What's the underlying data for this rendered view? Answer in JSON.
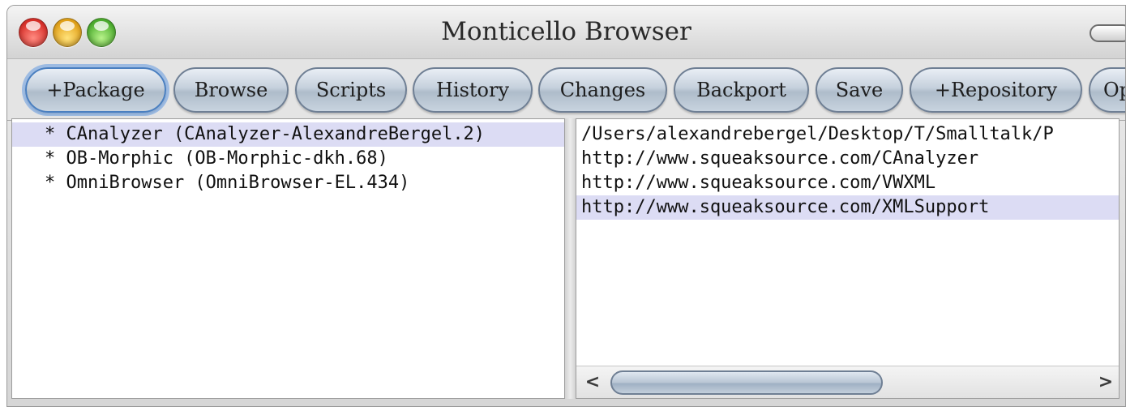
{
  "window": {
    "title": "Monticello Browser"
  },
  "toolbar": {
    "buttons": [
      {
        "label": "+Package"
      },
      {
        "label": "Browse"
      },
      {
        "label": "Scripts"
      },
      {
        "label": "History"
      },
      {
        "label": "Changes"
      },
      {
        "label": "Backport"
      },
      {
        "label": "Save"
      },
      {
        "label": "+Repository"
      },
      {
        "label": "Op"
      }
    ]
  },
  "packages": {
    "items": [
      {
        "label": "* CAnalyzer (CAnalyzer-AlexandreBergel.2)",
        "selected": true
      },
      {
        "label": "* OB-Morphic (OB-Morphic-dkh.68)",
        "selected": false
      },
      {
        "label": "* OmniBrowser (OmniBrowser-EL.434)",
        "selected": false
      }
    ]
  },
  "repositories": {
    "items": [
      {
        "label": "/Users/alexandrebergel/Desktop/T/Smalltalk/P",
        "selected": false
      },
      {
        "label": "http://www.squeaksource.com/CAnalyzer",
        "selected": false
      },
      {
        "label": "http://www.squeaksource.com/VWXML",
        "selected": false
      },
      {
        "label": "http://www.squeaksource.com/XMLSupport",
        "selected": true
      }
    ],
    "scroll_left_glyph": "<",
    "scroll_right_glyph": ">"
  },
  "colors": {
    "selection": "#dcdcf4",
    "button_border": "#6f7f94",
    "focus_ring": "#6ea0e1"
  },
  "icons": {
    "close": "close-icon",
    "minimize": "minimize-icon",
    "zoom": "zoom-icon",
    "toolbar_toggle": "toolbar-toggle-icon"
  }
}
